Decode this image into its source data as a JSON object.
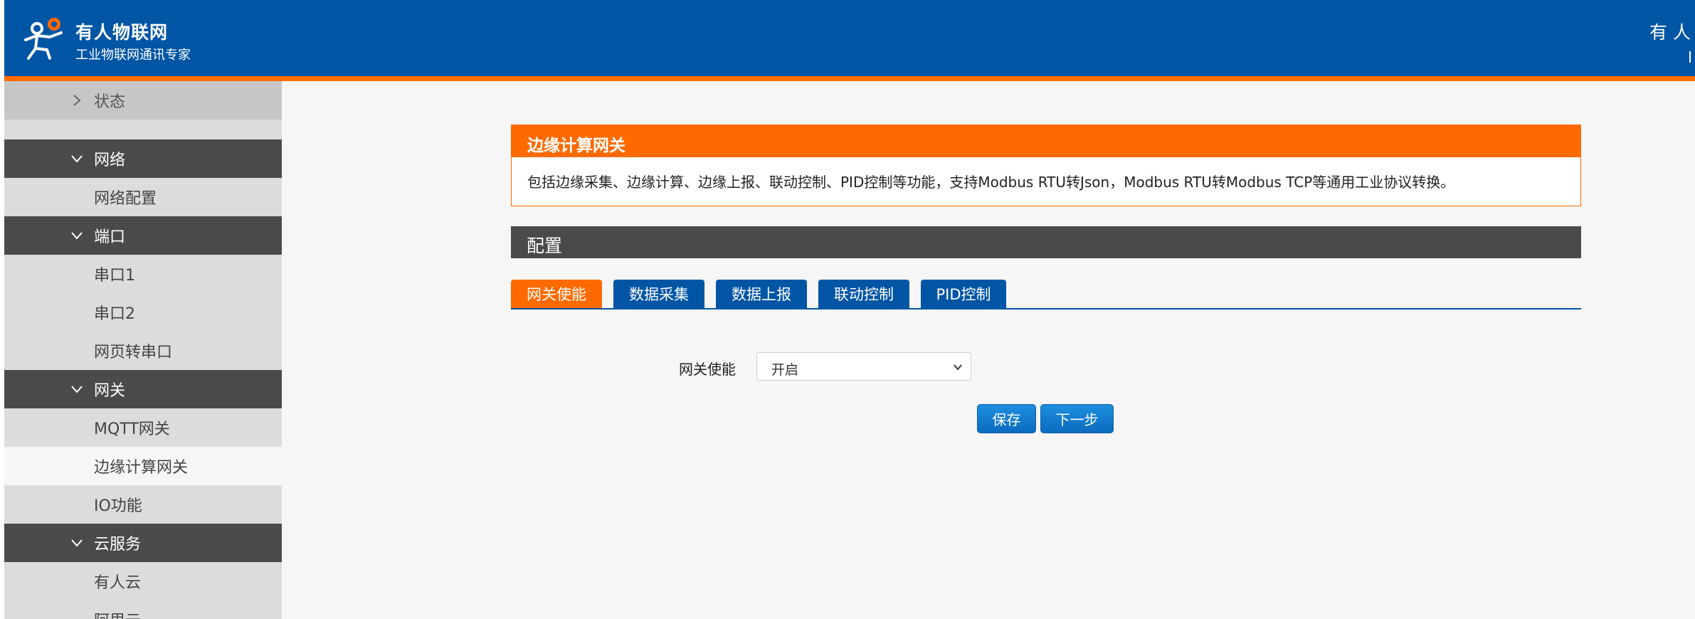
{
  "header": {
    "brand_name": "有人物联网",
    "brand_sub": "工业物联网通讯专家",
    "right_text": "有 人 物"
  },
  "sidebar": {
    "items": [
      {
        "label": "状态",
        "kind": "status",
        "chevron": "right"
      },
      {
        "label": "网络",
        "kind": "group",
        "chevron": "down"
      },
      {
        "label": "网络配置",
        "kind": "sub"
      },
      {
        "label": "端口",
        "kind": "group",
        "chevron": "down"
      },
      {
        "label": "串口1",
        "kind": "sub"
      },
      {
        "label": "串口2",
        "kind": "sub"
      },
      {
        "label": "网页转串口",
        "kind": "sub"
      },
      {
        "label": "网关",
        "kind": "group",
        "chevron": "down"
      },
      {
        "label": "MQTT网关",
        "kind": "sub"
      },
      {
        "label": "边缘计算网关",
        "kind": "active"
      },
      {
        "label": "IO功能",
        "kind": "sub"
      },
      {
        "label": "云服务",
        "kind": "group",
        "chevron": "down"
      },
      {
        "label": "有人云",
        "kind": "sub"
      },
      {
        "label": "阿里云",
        "kind": "sub"
      }
    ]
  },
  "info": {
    "title": "边缘计算网关",
    "text": "包括边缘采集、边缘计算、边缘上报、联动控制、PID控制等功能，支持Modbus RTU转Json，Modbus RTU转Modbus TCP等通用工业协议转换。"
  },
  "section": {
    "title": "配置"
  },
  "tabs": [
    {
      "label": "网关使能",
      "active": true
    },
    {
      "label": "数据采集",
      "active": false
    },
    {
      "label": "数据上报",
      "active": false
    },
    {
      "label": "联动控制",
      "active": false
    },
    {
      "label": "PID控制",
      "active": false
    }
  ],
  "form": {
    "gateway_enable_label": "网关使能",
    "gateway_enable_value": "开启"
  },
  "buttons": {
    "save": "保存",
    "next": "下一步"
  },
  "colors": {
    "brand_blue": "#0055a5",
    "accent_orange": "#ff6a00",
    "dark_gray": "#4a4a4a"
  }
}
